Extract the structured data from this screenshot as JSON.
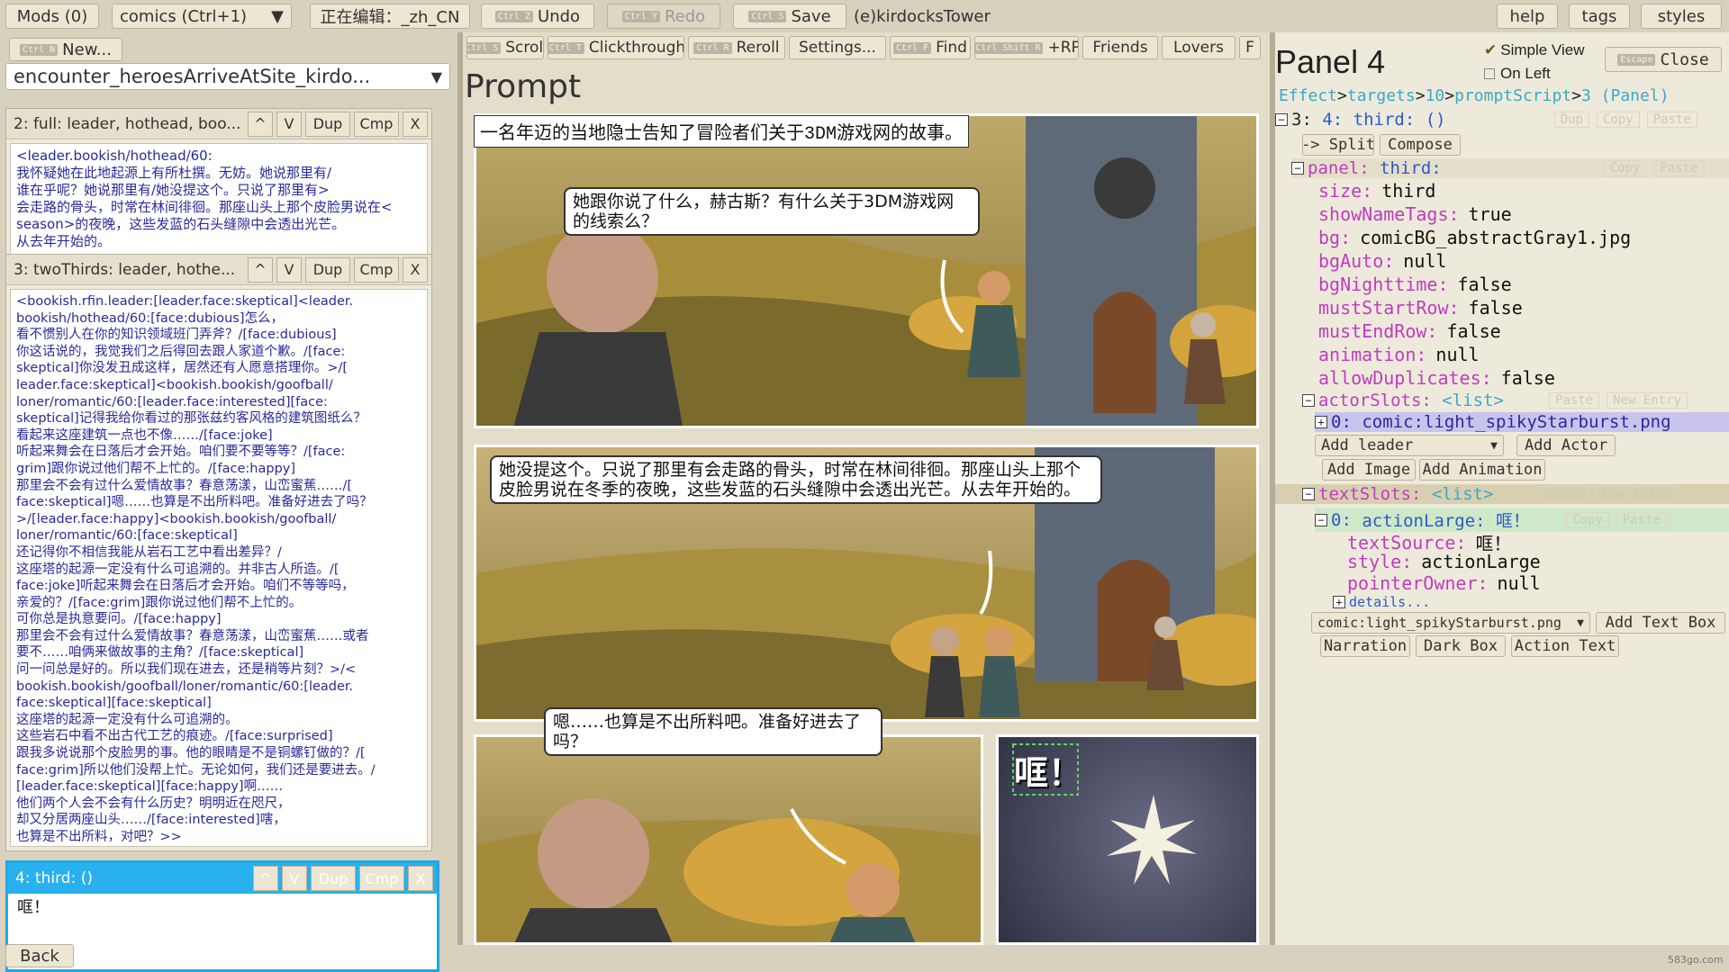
{
  "toolbar": {
    "mods": "Mods (0)",
    "comics_select": "comics (Ctrl+1)",
    "editing": "正在编辑：_zh_CN",
    "undo": "Undo",
    "redo": "Redo",
    "save": "Save",
    "project": "(e)kirdocksTower",
    "help": "help",
    "tags": "tags",
    "styles": "styles",
    "kbd_undo": "Ctrl Z",
    "kbd_redo": "Ctrl Y",
    "kbd_save": "Ctrl S"
  },
  "left": {
    "new_btn": "New...",
    "new_kbd": "Ctrl N",
    "encounter": "encounter_heroesArriveAtSite_kirdo...",
    "entries": [
      {
        "title": "2: full: leader, hothead, boo...",
        "text_lines": [
          "<leader.bookish/hothead/60:",
          "我怀疑她在此地起源上有所杜撰。无妨。她说那里有/",
          "谁在乎呢？她说那里有/她没提这个。只说了那里有>",
          "会走路的骨头，时常在林间徘徊。那座山头上那个皮脸男说在<",
          "season>的夜晚，这些发蓝的石头缝隙中会透出光芒。",
          "从去年开始的。"
        ]
      },
      {
        "title": "3: twoThirds: leader, hothe...",
        "text_lines": [
          "<bookish.rfin.leader:[leader.face:skeptical]<leader.",
          "bookish/hothead/60:[face:dubious]怎么，",
          "看不惯别人在你的知识领域班门弄斧？/[face:dubious]",
          "你这话说的，我觉我们之后得回去跟人家道个歉。/[face:",
          "skeptical]你没发丑成这样，居然还有人愿意搭理你。>/[",
          "leader.face:skeptical]<bookish.bookish/goofball/",
          "loner/romantic/60:[leader.face:interested][face:",
          "skeptical]记得我给你看过的那张兹约客风格的建筑图纸么？",
          "看起来这座建筑一点也不像……/[face:joke]",
          "听起来舞会在日落后才会开始。咱们要不要等等？/[face:",
          "grim]跟你说过他们帮不上忙的。/[face:happy]",
          "那里会不会有过什么爱情故事？春意荡漾，山峦蜜蕉……/[",
          "face:skeptical]嗯……也算是不出所料吧。准备好进去了吗？",
          ">/[leader.face:happy]<bookish.bookish/goofball/",
          "loner/romantic/60:[face:skeptical]",
          "还记得你不相信我能从岩石工艺中看出差异？/",
          "这座塔的起源一定没有什么可追溯的。并非古人所造。/[",
          "face:joke]听起来舞会在日落后才会开始。咱们不等等吗，",
          "亲爱的？/[face:grim]跟你说过他们帮不上忙的。",
          "可你总是执意要问。/[face:happy]",
          "那里会不会有过什么爱情故事？春意荡漾，山峦蜜蕉……或者",
          "要不……咱俩来做故事的主角？/[face:skeptical]",
          "问一问总是好的。所以我们现在进去，还是稍等片刻？>/<",
          "bookish.bookish/goofball/loner/romantic/60:[leader.",
          "face:skeptical][face:skeptical]",
          "这座塔的起源一定没有什么可追溯的。",
          "这些岩石中看不出古代工艺的痕迹。/[face:surprised]",
          "跟我多说说那个皮脸男的事。他的眼睛是不是铜螺钉做的？/[",
          "face:grim]所以他们没帮上忙。无论如何，我们还是要进去。/",
          "[leader.face:skeptical][face:happy]啊……",
          "他们两个人会不会有什么历史？明明近在咫尺，",
          "却又分居两座山头……/[face:interested]嗐，",
          "也算是不出所料，对吧？>>"
        ]
      },
      {
        "title": "4: third: ()",
        "text_lines": [
          "哐！"
        ]
      }
    ],
    "entry_buttons": {
      "up": "^",
      "down": "V",
      "dup": "Dup",
      "cmp": "Cmp",
      "del": "X"
    },
    "back": "Back"
  },
  "center": {
    "buttons": [
      "Scroll",
      "Clickthrough",
      "Reroll",
      "Settings...",
      "Find",
      "+RP",
      "Friends",
      "Lovers",
      "F"
    ],
    "kbds": [
      "Ctrl S",
      "Ctrl T",
      "Ctrl R",
      "",
      "Ctrl F",
      "Ctrl Shift R",
      "",
      "",
      ""
    ],
    "prompt_heading": "Prompt",
    "caption": "一名年迈的当地隐士告知了冒险者们关于3DM游戏网的故事。",
    "bubble1": "她跟你说了什么，赫古斯？有什么关于3DM游戏网的线索么？",
    "bubble2": "她没提这个。只说了那里有会走路的骨头，时常在林间徘徊。那座山头上那个皮脸男说在冬季的夜晚，这些发蓝的石头缝隙中会透出光芒。从去年开始的。",
    "bubble3": "嗯……也算是不出所料吧。准备好进去了吗？",
    "sfx": "哐！"
  },
  "right": {
    "title": "Panel 4",
    "simple_view": "Simple View",
    "on_left": "On Left",
    "close": "Close",
    "close_kbd": "Escape",
    "breadcrumb": [
      "Effect",
      "targets",
      "10",
      "promptScript",
      "3 (Panel)"
    ],
    "node_root": "3:",
    "node_root_val": "4: third: ()",
    "split": "-> Split",
    "compose": "Compose",
    "panel_key": "panel:",
    "panel_val": "third:",
    "fields": [
      {
        "k": "size:",
        "v": "third"
      },
      {
        "k": "showNameTags:",
        "v": "true"
      },
      {
        "k": "bg:",
        "v": "comicBG_abstractGray1.jpg"
      },
      {
        "k": "bgAuto:",
        "v": "null"
      },
      {
        "k": "bgNighttime:",
        "v": "false"
      },
      {
        "k": "mustStartRow:",
        "v": "false"
      },
      {
        "k": "mustEndRow:",
        "v": "false"
      },
      {
        "k": "animation:",
        "v": "null"
      },
      {
        "k": "allowDuplicates:",
        "v": "false"
      }
    ],
    "actor_slots": "actorSlots:",
    "list_tag": "<list>",
    "actor0": "0:",
    "actor0_val": "comic:light_spikyStarburst.png",
    "add_select": "Add leader",
    "add_actor": "Add Actor",
    "add_image": "Add Image",
    "add_animation": "Add Animation",
    "text_slots": "textSlots:",
    "text0": "0:",
    "text0_val": "actionLarge: 哐！",
    "text_fields": [
      {
        "k": "textSource:",
        "v": "哐！"
      },
      {
        "k": "style:",
        "v": "actionLarge"
      },
      {
        "k": "pointerOwner:",
        "v": "null"
      }
    ],
    "details": "details...",
    "textbox_select": "comic:light_spikyStarburst.png",
    "add_textbox": "Add Text Box",
    "narration": "Narration",
    "dark_box": "Dark Box",
    "action_text": "Action Text",
    "faint": {
      "copy": "Copy",
      "paste": "Paste",
      "new": "New",
      "new_entry": "New Entry",
      "null": "null",
      "dup": "Dup"
    }
  },
  "watermark": "583go.com"
}
